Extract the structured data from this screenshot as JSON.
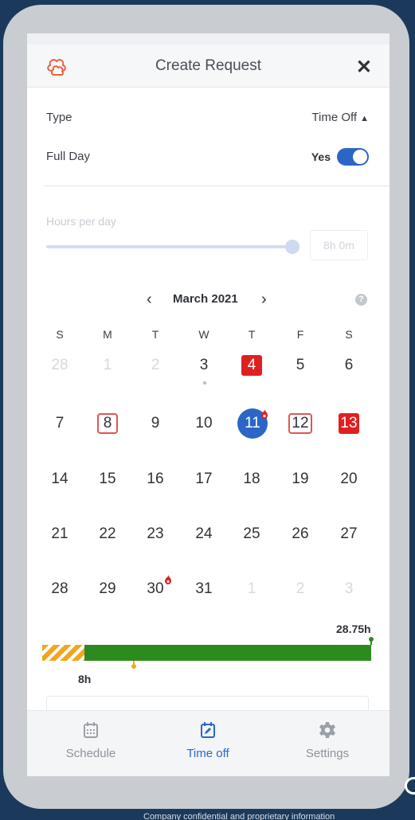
{
  "header": {
    "title": "Create Request",
    "close_label": "✕"
  },
  "form": {
    "type_label": "Type",
    "type_value": "Time Off",
    "full_day_label": "Full Day",
    "full_day_value": "Yes",
    "full_day_on": true,
    "hours_label": "Hours per day",
    "hours_value": "8h 0m"
  },
  "calendar": {
    "month": "March 2021",
    "prev_label": "‹",
    "next_label": "›",
    "help_label": "?",
    "weekdays": [
      "S",
      "M",
      "T",
      "W",
      "T",
      "F",
      "S"
    ],
    "weeks": [
      [
        {
          "d": "28",
          "muted": true
        },
        {
          "d": "1",
          "muted": true
        },
        {
          "d": "2",
          "muted": true
        },
        {
          "d": "3",
          "dot": true
        },
        {
          "d": "4",
          "style": "filled"
        },
        {
          "d": "5"
        },
        {
          "d": "6"
        }
      ],
      [
        {
          "d": "7"
        },
        {
          "d": "8",
          "style": "outlined"
        },
        {
          "d": "9"
        },
        {
          "d": "10"
        },
        {
          "d": "11",
          "style": "today",
          "flag": true
        },
        {
          "d": "12",
          "style": "outlined"
        },
        {
          "d": "13",
          "style": "filled"
        }
      ],
      [
        {
          "d": "14"
        },
        {
          "d": "15"
        },
        {
          "d": "16"
        },
        {
          "d": "17"
        },
        {
          "d": "18"
        },
        {
          "d": "19"
        },
        {
          "d": "20"
        }
      ],
      [
        {
          "d": "21"
        },
        {
          "d": "22"
        },
        {
          "d": "23"
        },
        {
          "d": "24"
        },
        {
          "d": "25"
        },
        {
          "d": "26"
        },
        {
          "d": "27"
        }
      ],
      [
        {
          "d": "28"
        },
        {
          "d": "29"
        },
        {
          "d": "30",
          "flag": true
        },
        {
          "d": "31"
        },
        {
          "d": "1",
          "muted": true
        },
        {
          "d": "2",
          "muted": true
        },
        {
          "d": "3",
          "muted": true
        }
      ]
    ]
  },
  "balance": {
    "total_label": "28.75h",
    "used_label": "8h",
    "total_hours": 28.75,
    "used_hours": 8,
    "used_color": "#f2a51f",
    "remaining_color": "#2d8a1e"
  },
  "tabs": [
    {
      "label": "Schedule",
      "icon": "calendar-icon"
    },
    {
      "label": "Time off",
      "icon": "calendar-edit-icon",
      "active": true
    },
    {
      "label": "Settings",
      "icon": "gear-icon"
    }
  ],
  "footer": {
    "text": "Company confidential and proprietary information"
  },
  "colors": {
    "accent": "#2b66c7",
    "danger": "#e02020",
    "logo": "#e8603c",
    "background": "#1b3a5b"
  }
}
